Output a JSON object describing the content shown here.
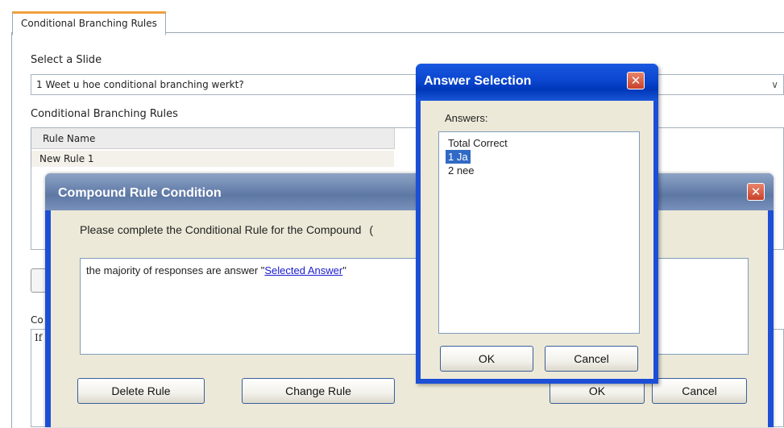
{
  "background": {
    "tab_label": "Conditional Branching Rules",
    "select_slide_label": "Select a Slide",
    "selected_slide": "1 Weet u hoe conditional branching werkt?",
    "rules_label": "Conditional Branching Rules",
    "rules_column_header": "Rule Name",
    "rules": [
      "New Rule 1"
    ],
    "condition_label_partial": "Co",
    "condition_text_partial": "If"
  },
  "compound_dialog": {
    "title": "Compound Rule Condition",
    "close_glyph": "✕",
    "prompt": "Please complete the Conditional Rule for the Compound",
    "prompt_tail": "(",
    "condition_prefix": "the majority of responses are answer \"",
    "condition_link": "Selected Answer",
    "condition_suffix": "\"",
    "delete_label": "Delete Rule",
    "change_label": "Change Rule",
    "ok_label": "OK",
    "cancel_label": "Cancel"
  },
  "answer_dialog": {
    "title": "Answer Selection",
    "close_glyph": "✕",
    "answers_label": "Answers:",
    "answers": [
      "Total Correct",
      "1 Ja",
      "2 nee"
    ],
    "selected_answer": "1 Ja",
    "ok_label": "OK",
    "cancel_label": "Cancel"
  },
  "colors": {
    "xp_blue": "#1c4fd6",
    "dialog_face": "#ece9d8",
    "selection": "#316ac5",
    "close_red": "#c9402a",
    "tab_accent": "#f0a040"
  }
}
